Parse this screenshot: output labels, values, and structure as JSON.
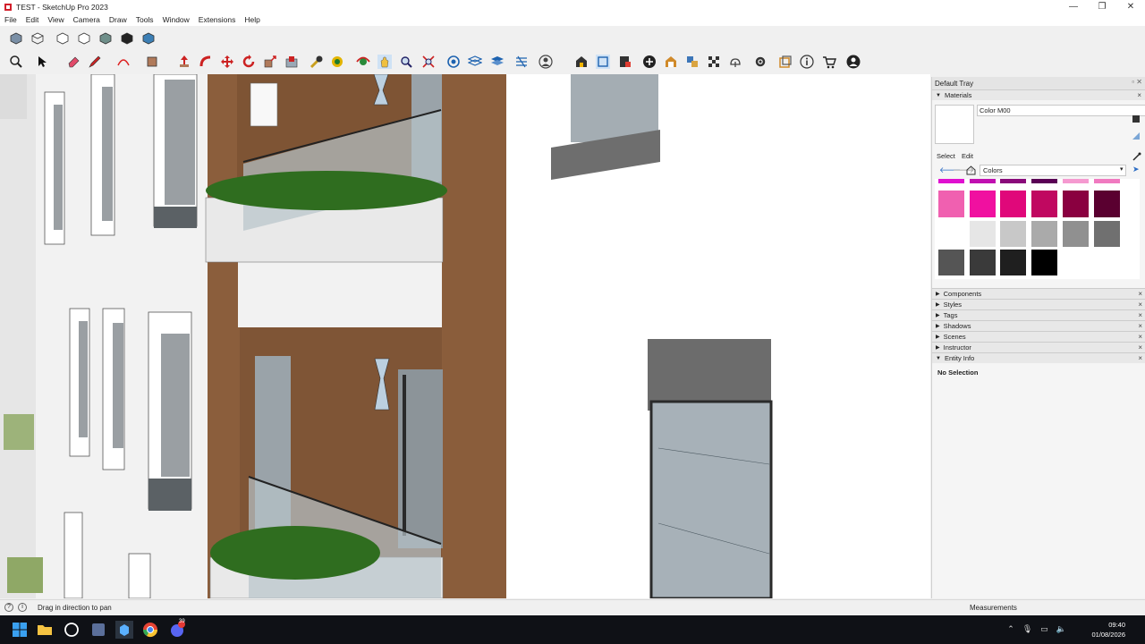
{
  "window": {
    "title": "TEST - SketchUp Pro 2023",
    "controls": [
      "—",
      "❐",
      "✕"
    ]
  },
  "menu": [
    "File",
    "Edit",
    "View",
    "Camera",
    "Draw",
    "Tools",
    "Window",
    "Extensions",
    "Help"
  ],
  "toolbar1_icons": [
    "iso-view-icon",
    "top-view-icon",
    "front-view-icon",
    "right-view-icon",
    "back-view-icon",
    "left-view-icon",
    "bottom-view-icon"
  ],
  "toolbar2_icons": [
    "zoom-icon",
    "select-icon",
    "eraser-icon",
    "pencil-icon",
    "arc-icon",
    "rectangle-icon",
    "push-pull-icon",
    "follow-me-icon",
    "move-icon",
    "rotate-icon",
    "scale-icon",
    "offset-icon",
    "tape-measure-icon",
    "paint-bucket-icon",
    "orbit-icon",
    "pan-icon",
    "zoom-tool-icon",
    "zoom-extents-icon",
    "section-plane-icon",
    "section-display-icon",
    "section-cut-icon",
    "section-fill-icon",
    "account-icon",
    "warehouse-icon",
    "extension-warehouse-icon",
    "layout-icon",
    "add-location-icon",
    "photo-texture-icon",
    "styles-icon",
    "preview-icon",
    "tilt-icon",
    "dynamic-components-icon",
    "interact-icon",
    "info-icon",
    "store-icon",
    "profile-icon"
  ],
  "tray": {
    "title": "Default Tray",
    "materials": {
      "header": "Materials",
      "current_name": "Color M00",
      "tabs": {
        "select": "Select",
        "edit": "Edit"
      },
      "library": "Colors",
      "swatch_rows": [
        [
          "#e010d0",
          "#c010b0",
          "#8a0a7a",
          "#5a0055",
          "#f59ad0",
          "#f07ac0"
        ],
        [
          "#f060b0",
          "#f010a0",
          "#e0087a",
          "#c00860",
          "#8a0040",
          "#5a0030"
        ],
        [
          "#ffffff",
          "#e6e6e6",
          "#c8c8c8",
          "#aaaaaa",
          "#909090",
          "#707070"
        ],
        [
          "#555555",
          "#3a3a3a",
          "#1f1f1f",
          "#000000"
        ]
      ]
    },
    "panels": [
      "Components",
      "Styles",
      "Tags",
      "Shadows",
      "Scenes",
      "Instructor",
      "Entity Info"
    ],
    "entity_info": "No Selection"
  },
  "status": {
    "hint": "Drag in direction to pan",
    "measurements": "Measurements"
  },
  "taskbar": {
    "time": "09:40",
    "date": "01/08/2026",
    "chat_badge": "39"
  }
}
